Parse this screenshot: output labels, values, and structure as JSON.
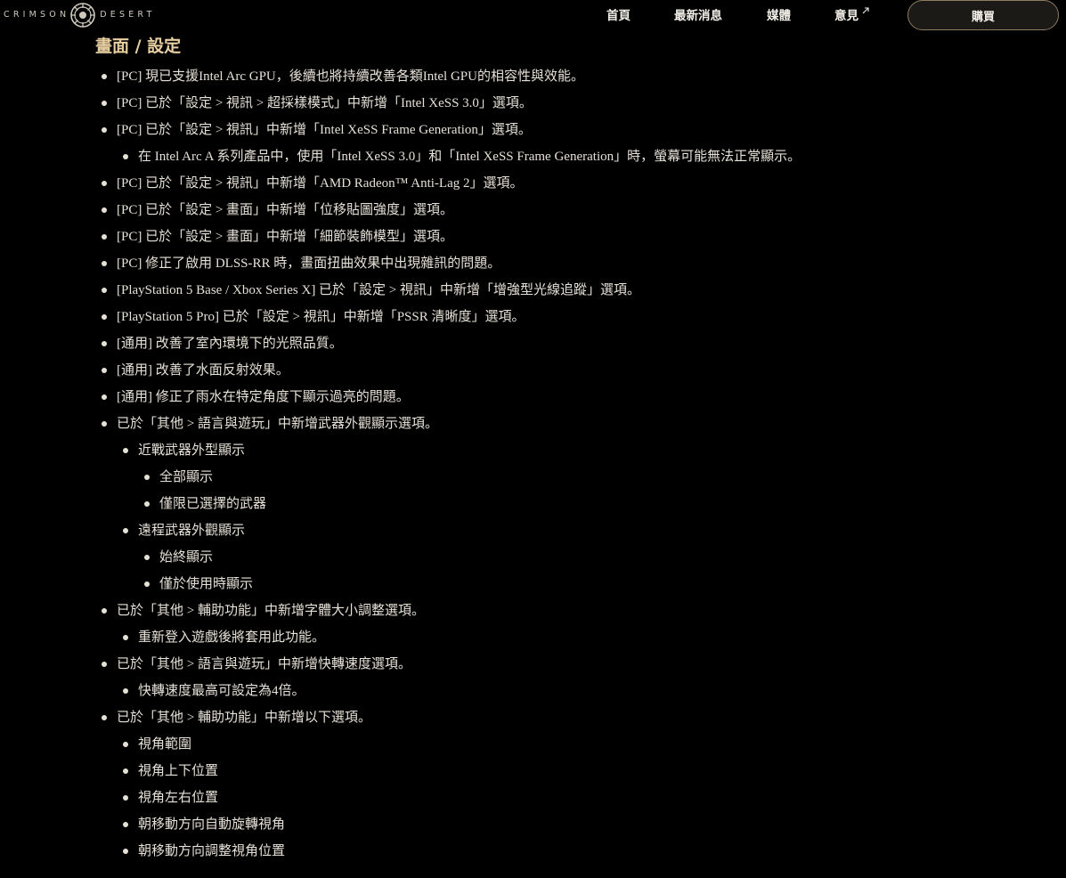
{
  "brand": {
    "left_word": "CRIMSON",
    "right_word": "DESERT"
  },
  "nav": {
    "items": [
      {
        "label": "首頁",
        "external": false
      },
      {
        "label": "最新消息",
        "external": false
      },
      {
        "label": "媒體",
        "external": false
      },
      {
        "label": "意見",
        "external": true
      }
    ],
    "buy_label": "購買"
  },
  "section": {
    "title": "畫面 / 設定",
    "items": [
      {
        "level": 0,
        "text": "[PC] 現已支援Intel Arc GPU，後續也將持續改善各類Intel GPU的相容性與效能。"
      },
      {
        "level": 0,
        "text": "[PC] 已於「設定 > 視訊 > 超採樣模式」中新增「Intel XeSS 3.0」選項。"
      },
      {
        "level": 0,
        "text": "[PC] 已於「設定 > 視訊」中新增「Intel XeSS Frame Generation」選項。"
      },
      {
        "level": 1,
        "text": "在 Intel Arc A 系列產品中，使用「Intel XeSS 3.0」和「Intel XeSS Frame Generation」時，螢幕可能無法正常顯示。"
      },
      {
        "level": 0,
        "text": "[PC] 已於「設定 > 視訊」中新增「AMD Radeon™ Anti-Lag 2」選項。"
      },
      {
        "level": 0,
        "text": "[PC] 已於「設定 > 畫面」中新增「位移貼圖強度」選項。"
      },
      {
        "level": 0,
        "text": "[PC] 已於「設定 > 畫面」中新增「細節裝飾模型」選項。"
      },
      {
        "level": 0,
        "text": "[PC] 修正了啟用 DLSS-RR 時，畫面扭曲效果中出現雜訊的問題。"
      },
      {
        "level": 0,
        "text": "[PlayStation 5 Base / Xbox Series X] 已於「設定 > 視訊」中新增「增強型光線追蹤」選項。"
      },
      {
        "level": 0,
        "text": "[PlayStation 5 Pro] 已於「設定 > 視訊」中新增「PSSR 清晰度」選項。"
      },
      {
        "level": 0,
        "text": "[通用] 改善了室內環境下的光照品質。"
      },
      {
        "level": 0,
        "text": "[通用] 改善了水面反射效果。"
      },
      {
        "level": 0,
        "text": "[通用] 修正了雨水在特定角度下顯示過亮的問題。"
      },
      {
        "level": 0,
        "text": "已於「其他 > 語言與遊玩」中新增武器外觀顯示選項。"
      },
      {
        "level": 1,
        "text": "近戰武器外型顯示"
      },
      {
        "level": 2,
        "text": "全部顯示"
      },
      {
        "level": 2,
        "text": "僅限已選擇的武器"
      },
      {
        "level": 1,
        "text": "遠程武器外觀顯示"
      },
      {
        "level": 2,
        "text": "始終顯示"
      },
      {
        "level": 2,
        "text": "僅於使用時顯示"
      },
      {
        "level": 0,
        "text": "已於「其他 > 輔助功能」中新增字體大小調整選項。"
      },
      {
        "level": 1,
        "text": "重新登入遊戲後將套用此功能。"
      },
      {
        "level": 0,
        "text": "已於「其他 > 語言與遊玩」中新增快轉速度選項。"
      },
      {
        "level": 1,
        "text": "快轉速度最高可設定為4倍。"
      },
      {
        "level": 0,
        "text": "已於「其他 > 輔助功能」中新增以下選項。"
      },
      {
        "level": 1,
        "text": "視角範圍"
      },
      {
        "level": 1,
        "text": "視角上下位置"
      },
      {
        "level": 1,
        "text": "視角左右位置"
      },
      {
        "level": 1,
        "text": "朝移動方向自動旋轉視角"
      },
      {
        "level": 1,
        "text": "朝移動方向調整視角位置"
      }
    ]
  }
}
